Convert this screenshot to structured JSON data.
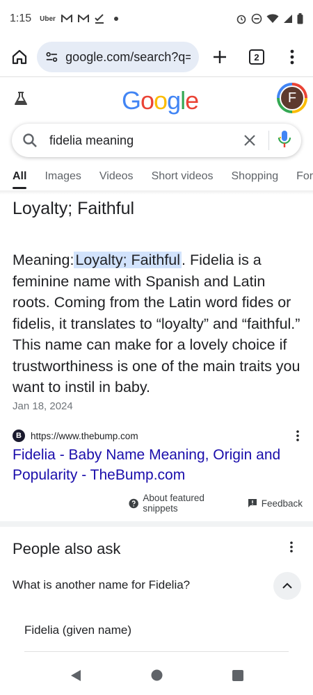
{
  "status_bar": {
    "time": "1:15",
    "uber_label": "Uber"
  },
  "browser": {
    "url": "google.com/search?q=fi",
    "tab_count": "2"
  },
  "google": {
    "logo_letters": [
      "G",
      "o",
      "o",
      "g",
      "l",
      "e"
    ],
    "logo_colors": [
      "#4285f4",
      "#ea4335",
      "#fbbc05",
      "#4285f4",
      "#34a853",
      "#ea4335"
    ],
    "avatar_letter": "F"
  },
  "search": {
    "query": "fidelia meaning"
  },
  "tabs": [
    "All",
    "Images",
    "Videos",
    "Short videos",
    "Shopping",
    "Forums"
  ],
  "snippet": {
    "title": "Loyalty; Faithful",
    "meaning_prefix": "Meaning:",
    "highlight": "Loyalty; Faithful",
    "body_rest": ". Fidelia is a feminine name with Spanish and Latin roots. Coming from the Latin word fides or fidelis, it translates to “loyalty” and “faithful.” This name can make for a lovely choice if trustworthiness is one of the main traits you want to instil in baby.",
    "date": "Jan 18, 2024",
    "favicon_letter": "B",
    "source_url": "https://www.thebump.com",
    "link_title": "Fidelia - Baby Name Meaning, Origin and Popularity - TheBump.com",
    "about_label": "About featured snippets",
    "feedback_label": "Feedback"
  },
  "paa": {
    "title": "People also ask",
    "question": "What is another name for Fidelia?",
    "answer": "Fidelia (given name)"
  }
}
